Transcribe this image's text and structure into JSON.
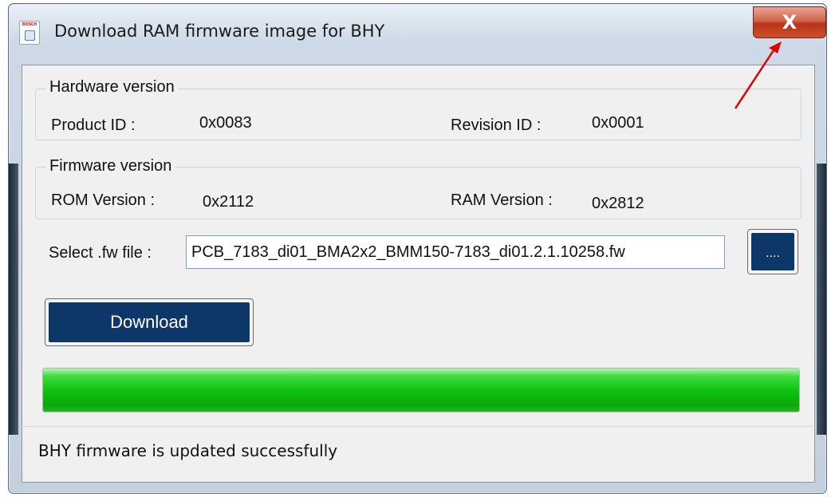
{
  "window": {
    "title": "Download RAM firmware image for BHY",
    "app_icon_brand": "BOSCH",
    "close_glyph": "X"
  },
  "hardware": {
    "group_label": "Hardware version",
    "product_id_label": "Product ID :",
    "product_id_value": "0x0083",
    "revision_id_label": "Revision ID :",
    "revision_id_value": "0x0001"
  },
  "firmware": {
    "group_label": "Firmware version",
    "rom_label": "ROM Version :",
    "rom_value": "0x2112",
    "ram_label": "RAM Version :",
    "ram_value": "0x2812"
  },
  "file": {
    "label": "Select .fw file :",
    "value": "PCB_7183_di01_BMA2x2_BMM150-7183_di01.2.1.10258.fw",
    "browse_label": "...."
  },
  "actions": {
    "download_label": "Download"
  },
  "progress": {
    "value": 1.0
  },
  "status": {
    "text": "BHY firmware is updated successfully"
  },
  "colors": {
    "button_fill": "#0e3769",
    "progress_fill": "#11c411",
    "annotation_arrow": "#e00000"
  },
  "icons": {
    "app": "app-window-icon",
    "close": "close-icon"
  }
}
